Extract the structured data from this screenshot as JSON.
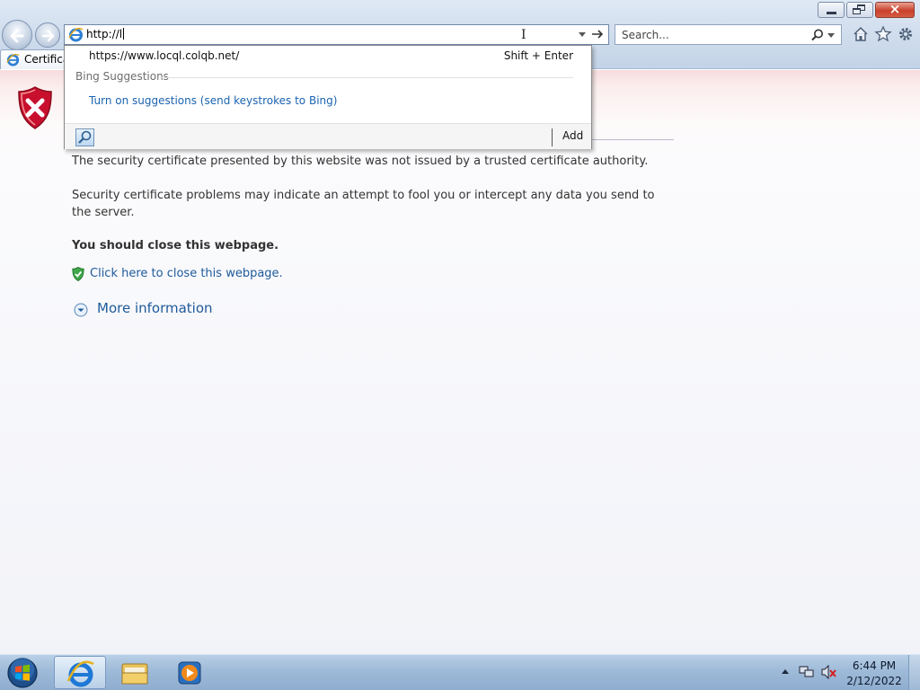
{
  "browser": {
    "address": {
      "value": "http://l"
    },
    "search": {
      "placeholder": "Search..."
    },
    "tab": {
      "label": "Certificate"
    }
  },
  "autocomplete": {
    "url_suggestion": "https://www.locql.colqb.net/",
    "shortcut": "Shift + Enter",
    "section_heading": "Bing Suggestions",
    "turn_on_link": "Turn on suggestions (send keystrokes to Bing)",
    "add_label": "Add"
  },
  "page": {
    "paragraph1": "The security certificate presented by this website was not issued by a trusted certificate authority.",
    "paragraph2": "Security certificate problems may indicate an attempt to fool you or intercept any data you send to the server.",
    "advice": "You should close this webpage.",
    "close_link": "Click here to close this webpage.",
    "more_info": "More information"
  },
  "taskbar": {
    "apps": [
      "internet-explorer-icon",
      "windows-explorer-icon",
      "media-player-icon"
    ],
    "clock_time": "6:44 PM",
    "clock_date": "2/12/2022"
  },
  "colors": {
    "link": "#1e5a9a",
    "suggestion_link": "#1b64b0",
    "error_red": "#c8102e",
    "chrome_blue": "#cfdcec"
  }
}
